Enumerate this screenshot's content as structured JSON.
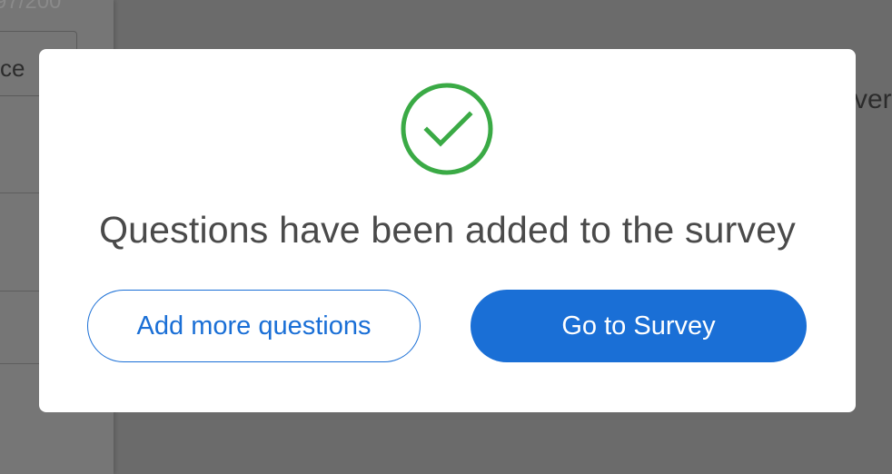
{
  "background": {
    "counter_text": "97/200",
    "choice_text": "ce",
    "right_text": "ver"
  },
  "modal": {
    "icon": "check-circle-icon",
    "icon_color": "#3aaa45",
    "title": "Questions have been added to the survey",
    "secondary_button_label": "Add more questions",
    "primary_button_label": "Go to Survey",
    "accent_color": "#1a6fd6"
  }
}
